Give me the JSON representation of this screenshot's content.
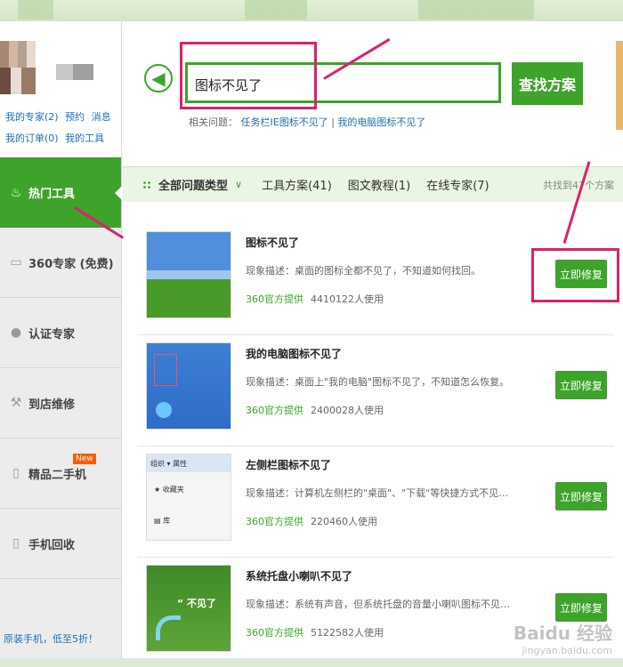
{
  "sidebar": {
    "profile_links": [
      "我的专家(2)",
      "预约",
      "消息",
      "我的订单(0)",
      "我的工具"
    ],
    "items": [
      {
        "label": "热门工具",
        "icon": "flame-icon",
        "glyph": "♨",
        "active": true
      },
      {
        "label": "360专家 (免费)",
        "icon": "monitor-icon",
        "glyph": "▭"
      },
      {
        "label": "认证专家",
        "icon": "person-icon",
        "glyph": "●"
      },
      {
        "label": "到店维修",
        "icon": "wrench-icon",
        "glyph": "⚒"
      },
      {
        "label": "精品二手机",
        "icon": "phone-icon",
        "glyph": "▯",
        "badge": "New"
      },
      {
        "label": "手机回收",
        "icon": "recycle-phone-icon",
        "glyph": "▯"
      }
    ],
    "promo": "原装手机，低至5折！"
  },
  "search": {
    "value": "图标不见了",
    "button": "查找方案",
    "related_label": "相关问题：",
    "related": [
      "任务栏IE图标不见了",
      "我的电脑图标不见了"
    ]
  },
  "filters": {
    "all": "全部问题类型",
    "tabs": [
      "工具方案(41)",
      "图文教程(1)",
      "在线专家(7)"
    ],
    "found": "共找到47个方案"
  },
  "results": [
    {
      "title": "图标不见了",
      "desc": "现象描述：桌面的图标全都不见了，不知道如何找回。",
      "source": "360官方提供",
      "users": "4410122人使用",
      "button": "立即修复"
    },
    {
      "title": "我的电脑图标不见了",
      "desc": "现象描述：桌面上\"我的电脑\"图标不见了，不知道怎么恢复。",
      "source": "360官方提供",
      "users": "2400028人使用",
      "button": "立即修复"
    },
    {
      "title": "左侧栏图标不见了",
      "desc": "现象描述：计算机左侧栏的\"桌面\"、\"下载\"等快捷方式不见了或显示异...",
      "source": "360官方提供",
      "users": "220460人使用",
      "button": "立即修复"
    },
    {
      "title": "系统托盘小喇叭不见了",
      "desc": "现象描述：系统有声音，但系统托盘的音量小喇叭图标不见了。",
      "source": "360官方提供",
      "users": "5122582人使用",
      "button": "立即修复"
    }
  ],
  "thumb_labels": {
    "t3_a": "组织 ▾",
    "t3_b": "属性",
    "t3_c": "收藏夹",
    "t3_d": "库",
    "t4": "“ 不见了"
  },
  "watermark": {
    "main": "Baidu 经验",
    "sub": "jingyan.baidu.com"
  },
  "colors": {
    "accent": "#3ea32a",
    "highlight": "#d8236c",
    "link": "#1f6fb3"
  }
}
